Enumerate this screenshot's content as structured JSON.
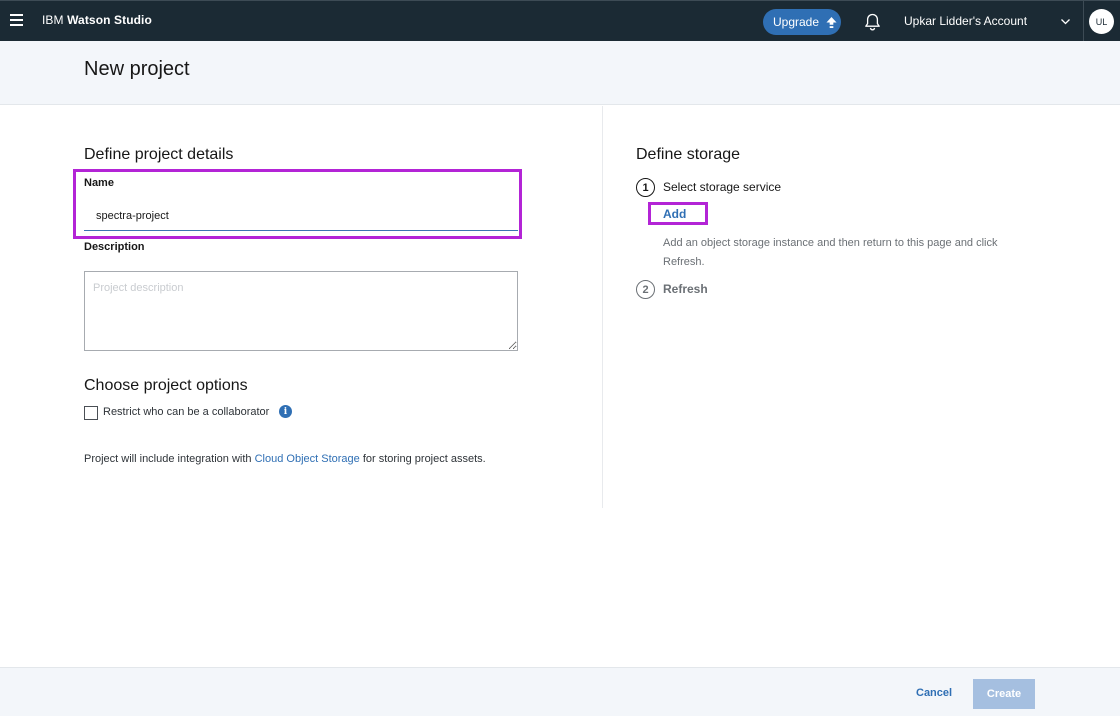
{
  "header": {
    "brand_prefix": "IBM ",
    "brand_name": "Watson Studio",
    "upgrade_label": "Upgrade",
    "account_name": "Upkar Lidder's Account",
    "avatar_initials": "UL"
  },
  "page": {
    "title": "New project"
  },
  "details": {
    "heading": "Define project details",
    "name_label": "Name",
    "name_value": "spectra-project",
    "description_label": "Description",
    "description_placeholder": "Project description"
  },
  "options": {
    "heading": "Choose project options",
    "restrict_label": "Restrict who can be a collaborator",
    "integration_prefix": "Project will include integration with ",
    "integration_link": "Cloud Object Storage",
    "integration_suffix": " for storing project assets."
  },
  "storage": {
    "heading": "Define storage",
    "step1_number": "1",
    "step1_title": "Select storage service",
    "add_label": "Add",
    "help_text": "Add an object storage instance and then return to this page and click Refresh.",
    "step2_number": "2",
    "step2_title": "Refresh"
  },
  "footer": {
    "cancel_label": "Cancel",
    "create_label": "Create"
  },
  "colors": {
    "header_bg": "#1b2a34",
    "accent": "#2f6fb4",
    "highlight": "#b324d6",
    "create_disabled": "#a5bfe0"
  },
  "icons": [
    "hamburger-menu-icon",
    "arrow-up-icon",
    "bell-icon",
    "chevron-down-icon",
    "info-icon"
  ]
}
